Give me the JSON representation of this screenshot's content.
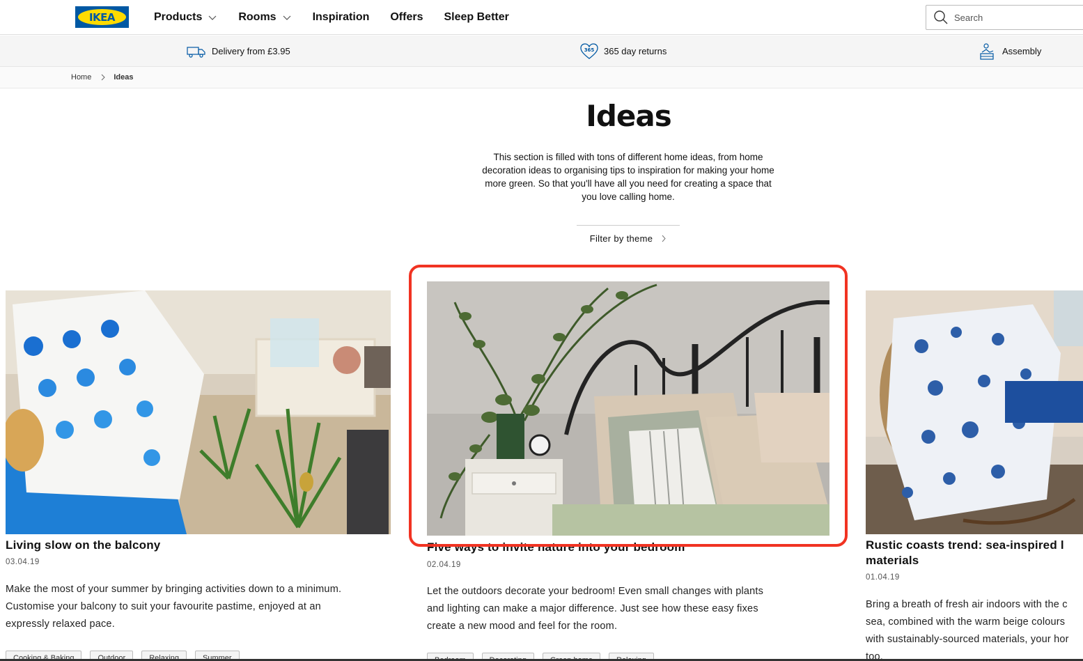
{
  "header": {
    "logo_text": "IKEA",
    "nav": [
      {
        "label": "Products",
        "has_dropdown": true
      },
      {
        "label": "Rooms",
        "has_dropdown": true
      },
      {
        "label": "Inspiration",
        "has_dropdown": false
      },
      {
        "label": "Offers",
        "has_dropdown": false
      },
      {
        "label": "Sleep Better",
        "has_dropdown": false
      }
    ],
    "search_placeholder": "Search"
  },
  "infobar": {
    "delivery": "Delivery from £3.95",
    "returns": "365 day returns",
    "returns_badge": "365",
    "assembly": "Assembly"
  },
  "breadcrumb": {
    "home": "Home",
    "current": "Ideas"
  },
  "hero": {
    "title": "Ideas",
    "intro": "This section is filled with tons of different home ideas, from home decoration ideas to organising tips to inspiration for making your home more green. So that you'll have all you need for creating a space that you love calling home.",
    "filter_label": "Filter by theme"
  },
  "cards": [
    {
      "title": "Living slow on the balcony",
      "date": "03.04.19",
      "description": "Make the most of your summer by bringing activities down to a minimum. Customise your balcony to suit your favourite pastime, enjoyed at an expressly relaxed pace.",
      "tags": [
        "Cooking & Baking",
        "Outdoor",
        "Relaxing",
        "Summer"
      ]
    },
    {
      "title": "Five ways to invite nature into your bedroom",
      "date": "02.04.19",
      "description": "Let the outdoors decorate your bedroom! Even small changes with plants and lighting can make a major difference. Just see how these easy fixes create a new mood and feel for the room.",
      "tags": [
        "Bedroom",
        "Decorating",
        "Green home",
        "Relaxing"
      ]
    },
    {
      "title": "Rustic coasts trend: sea-inspired l materials",
      "date": "01.04.19",
      "description": "Bring a breath of fresh air indoors with the c sea, combined with the warm beige colours with sustainably-sourced materials, your hor too."
    }
  ],
  "colors": {
    "brand_blue": "#0058a3",
    "brand_yellow": "#ffdb00",
    "highlight_red": "#f13322"
  }
}
